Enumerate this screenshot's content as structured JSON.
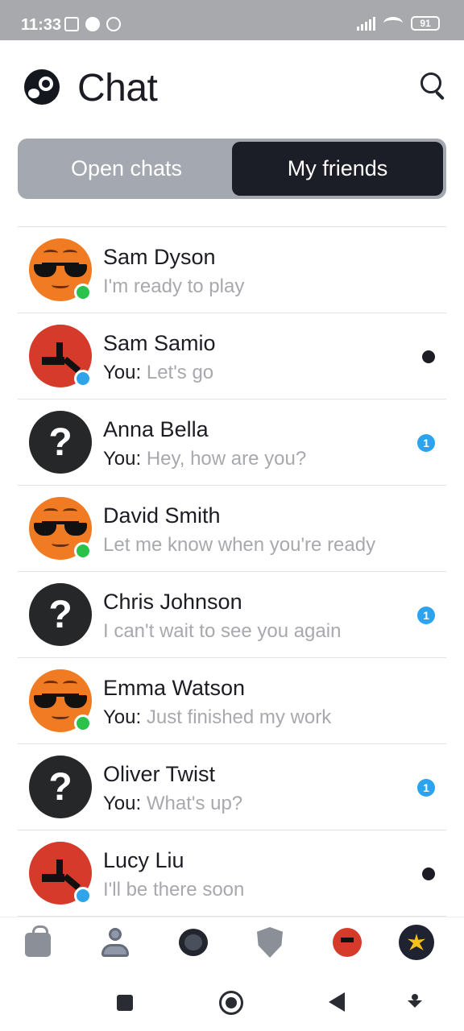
{
  "status_bar": {
    "time": "11:33",
    "battery": "91"
  },
  "header": {
    "title": "Chat"
  },
  "tabs": {
    "open_chats": "Open chats",
    "my_friends": "My friends",
    "active": "my_friends"
  },
  "chats": [
    {
      "name": "Sam Dyson",
      "you_prefix": "",
      "preview": "I'm ready to play",
      "avatar": "orange-sunglasses",
      "status": "online-green",
      "indicator": "none"
    },
    {
      "name": "Sam Samio",
      "you_prefix": "You:",
      "preview": "Let's go",
      "avatar": "red-tool",
      "status": "online-blue",
      "indicator": "dot"
    },
    {
      "name": "Anna Bella",
      "you_prefix": "You:",
      "preview": "Hey, how are you?",
      "avatar": "question-mark",
      "status": "none",
      "indicator": "badge",
      "badge_count": "1"
    },
    {
      "name": "David Smith",
      "you_prefix": "",
      "preview": "Let me know when you're ready",
      "avatar": "orange-sunglasses",
      "status": "online-green",
      "indicator": "none"
    },
    {
      "name": "Chris Johnson",
      "you_prefix": "",
      "preview": "I can't wait to see you again",
      "avatar": "question-mark",
      "status": "none",
      "indicator": "badge",
      "badge_count": "1"
    },
    {
      "name": "Emma Watson",
      "you_prefix": "You:",
      "preview": "Just finished my work",
      "avatar": "orange-sunglasses",
      "status": "online-green",
      "indicator": "none"
    },
    {
      "name": "Oliver Twist",
      "you_prefix": "You:",
      "preview": "What's up?",
      "avatar": "question-mark",
      "status": "none",
      "indicator": "badge",
      "badge_count": "1"
    },
    {
      "name": "Lucy Liu",
      "you_prefix": "",
      "preview": "I'll be there soon",
      "avatar": "red-tool",
      "status": "online-blue",
      "indicator": "dot"
    }
  ],
  "bottom_nav": [
    "store-bag-icon",
    "profile-icon",
    "chat-icon",
    "shield-icon",
    "avatar-red",
    "avatar-sun"
  ],
  "colors": {
    "accent_dark": "#1c1e27",
    "tab_bg": "#a4a8b0",
    "badge_blue": "#2ba3ee",
    "online_green": "#2ac24a",
    "online_blue": "#2fa4e8",
    "muted_text": "#a7a9ad"
  }
}
